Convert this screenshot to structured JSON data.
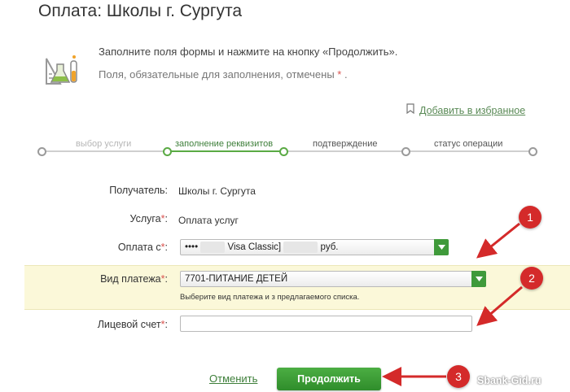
{
  "page": {
    "title": "Оплата: Школы г. Сургута"
  },
  "info": {
    "line1": "Заполните поля формы и нажмите на кнопку «Продолжить».",
    "line2": "Поля, обязательные для заполнения, отмечены",
    "required_mark": "*",
    "line2_end": "."
  },
  "favorite": {
    "label": "Добавить в избранное"
  },
  "steps": [
    {
      "label": "выбор услуги",
      "state": "past"
    },
    {
      "label": "заполнение реквизитов",
      "state": "current"
    },
    {
      "label": "подтверждение",
      "state": "upcoming"
    },
    {
      "label": "статус операции",
      "state": "upcoming"
    }
  ],
  "form": {
    "recipient": {
      "label": "Получатель:",
      "value": "Школы г. Сургута"
    },
    "service": {
      "label": "Услуга",
      "star": "*",
      "colon": ":",
      "value": "Оплата услуг"
    },
    "pay_from": {
      "label": "Оплата с",
      "star": "*",
      "colon": ":",
      "card_mask": "••••",
      "card_name": "Visa Classic]",
      "currency": "руб."
    },
    "payment_type": {
      "label": "Вид платежа",
      "star": "*",
      "colon": ":",
      "selected": "7701-ПИТАНИЕ ДЕТЕЙ",
      "help": "Выберите вид платежа и з предлагаемого списка."
    },
    "account": {
      "label": "Лицевой счет",
      "star": "*",
      "colon": ":",
      "value": ""
    }
  },
  "actions": {
    "cancel": "Отменить",
    "continue": "Продолжить"
  },
  "annotations": {
    "badge1": "1",
    "badge2": "2",
    "badge3": "3"
  },
  "watermark": "Sbank-Gid.ru",
  "colors": {
    "accent_green": "#3f9a3a",
    "annotation_red": "#d42a2a",
    "highlight": "#fbf8d9"
  },
  "icons": {
    "header": "lab-flask-icon",
    "favorite": "bookmark-icon",
    "dropdown": "chevron-down-icon"
  }
}
